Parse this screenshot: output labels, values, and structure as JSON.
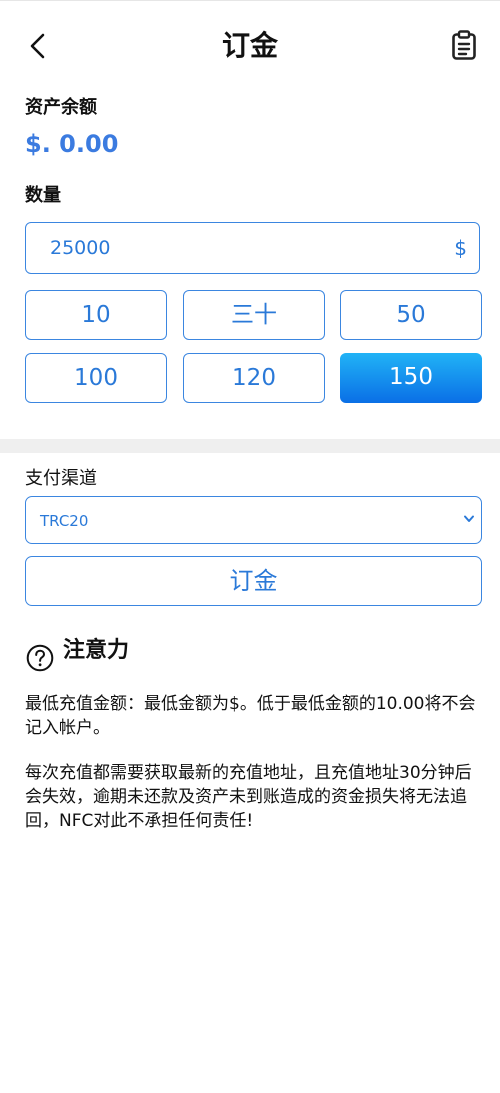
{
  "header": {
    "title": "订金",
    "back_icon": "back-arrow-icon",
    "clipboard_icon": "clipboard-icon"
  },
  "balance": {
    "label": "资产余额",
    "value": "$. 0.00",
    "color": "#3b7be0"
  },
  "amount": {
    "label": "数量",
    "value": "25000",
    "currency_symbol": "$"
  },
  "quick_amounts": [
    {
      "label": "10",
      "selected": false
    },
    {
      "label": "三十",
      "selected": false
    },
    {
      "label": "50",
      "selected": false
    },
    {
      "label": "100",
      "selected": false
    },
    {
      "label": "120",
      "selected": false
    },
    {
      "label": "150",
      "selected": true
    }
  ],
  "payment": {
    "label": "支付渠道",
    "selected_option": "TRC20"
  },
  "submit": {
    "label": "订金"
  },
  "notice": {
    "title": "注意力",
    "paragraphs": [
      "最低充值金额：最低金额为$。低于最低金额的10.00将不会记入帐户。",
      "每次充值都需要获取最新的充值地址，且充值地址30分钟后会失效，逾期未还款及资产未到账造成的资金损失将无法追回，NFC对此不承担任何责任!"
    ]
  },
  "colors": {
    "accent": "#2a79d8",
    "border": "#3b86e0",
    "active_gradient_top": "#21b3f6",
    "active_gradient_bottom": "#0a6fe6"
  }
}
